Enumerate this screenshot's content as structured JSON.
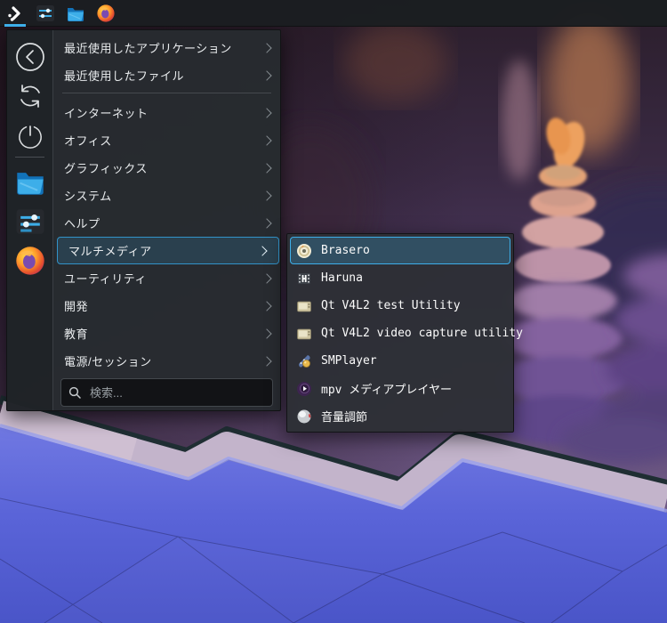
{
  "panel": {
    "items": [
      {
        "id": "app-launcher",
        "icon": "kde-launcher-icon",
        "active": true
      },
      {
        "id": "system-settings",
        "icon": "settings-sliders-icon",
        "active": false
      },
      {
        "id": "file-manager",
        "icon": "folder-icon",
        "active": false
      },
      {
        "id": "firefox",
        "icon": "firefox-icon",
        "active": false
      }
    ]
  },
  "launcher": {
    "sidebar": {
      "actions": [
        {
          "id": "back",
          "icon": "back-icon"
        },
        {
          "id": "restart",
          "icon": "restart-icon"
        },
        {
          "id": "shutdown",
          "icon": "shutdown-icon"
        }
      ],
      "favorites": [
        {
          "id": "file-manager",
          "icon": "folder-icon"
        },
        {
          "id": "system-settings",
          "icon": "settings-sliders-icon"
        },
        {
          "id": "firefox",
          "icon": "firefox-icon"
        }
      ]
    },
    "recent": [
      {
        "label": "最近使用したアプリケーション"
      },
      {
        "label": "最近使用したファイル"
      }
    ],
    "categories": [
      {
        "label": "インターネット"
      },
      {
        "label": "オフィス"
      },
      {
        "label": "グラフィックス"
      },
      {
        "label": "システム"
      },
      {
        "label": "ヘルプ"
      },
      {
        "label": "マルチメディア",
        "selected": true
      },
      {
        "label": "ユーティリティ"
      },
      {
        "label": "開発"
      },
      {
        "label": "教育"
      },
      {
        "label": "電源/セッション"
      }
    ],
    "search": {
      "placeholder": "検索..."
    }
  },
  "submenu": {
    "items": [
      {
        "label": "Brasero",
        "icon": "brasero-disc-icon",
        "selected": true
      },
      {
        "label": "Haruna",
        "icon": "haruna-player-icon",
        "selected": false
      },
      {
        "label": "Qt V4L2 test Utility",
        "icon": "v4l2-tv-icon",
        "selected": false
      },
      {
        "label": "Qt V4L2 video capture utility",
        "icon": "v4l2-tv-icon",
        "selected": false
      },
      {
        "label": "SMPlayer",
        "icon": "smplayer-icon",
        "selected": false
      },
      {
        "label": "mpv メディアプレイヤー",
        "icon": "mpv-icon",
        "selected": false
      },
      {
        "label": "音量調節",
        "icon": "volume-sphere-icon",
        "selected": false
      }
    ]
  },
  "colors": {
    "accent": "#3daee9",
    "panel_bg": "#1b1e21",
    "menu_bg": "#272b2f",
    "submenu_bg": "#2d3036",
    "highlight_border": "#3daee9",
    "wallpaper_blue": "#5a64d8",
    "wallpaper_purple": "#4e3a60",
    "wallpaper_lavender": "#c3b4cb"
  }
}
